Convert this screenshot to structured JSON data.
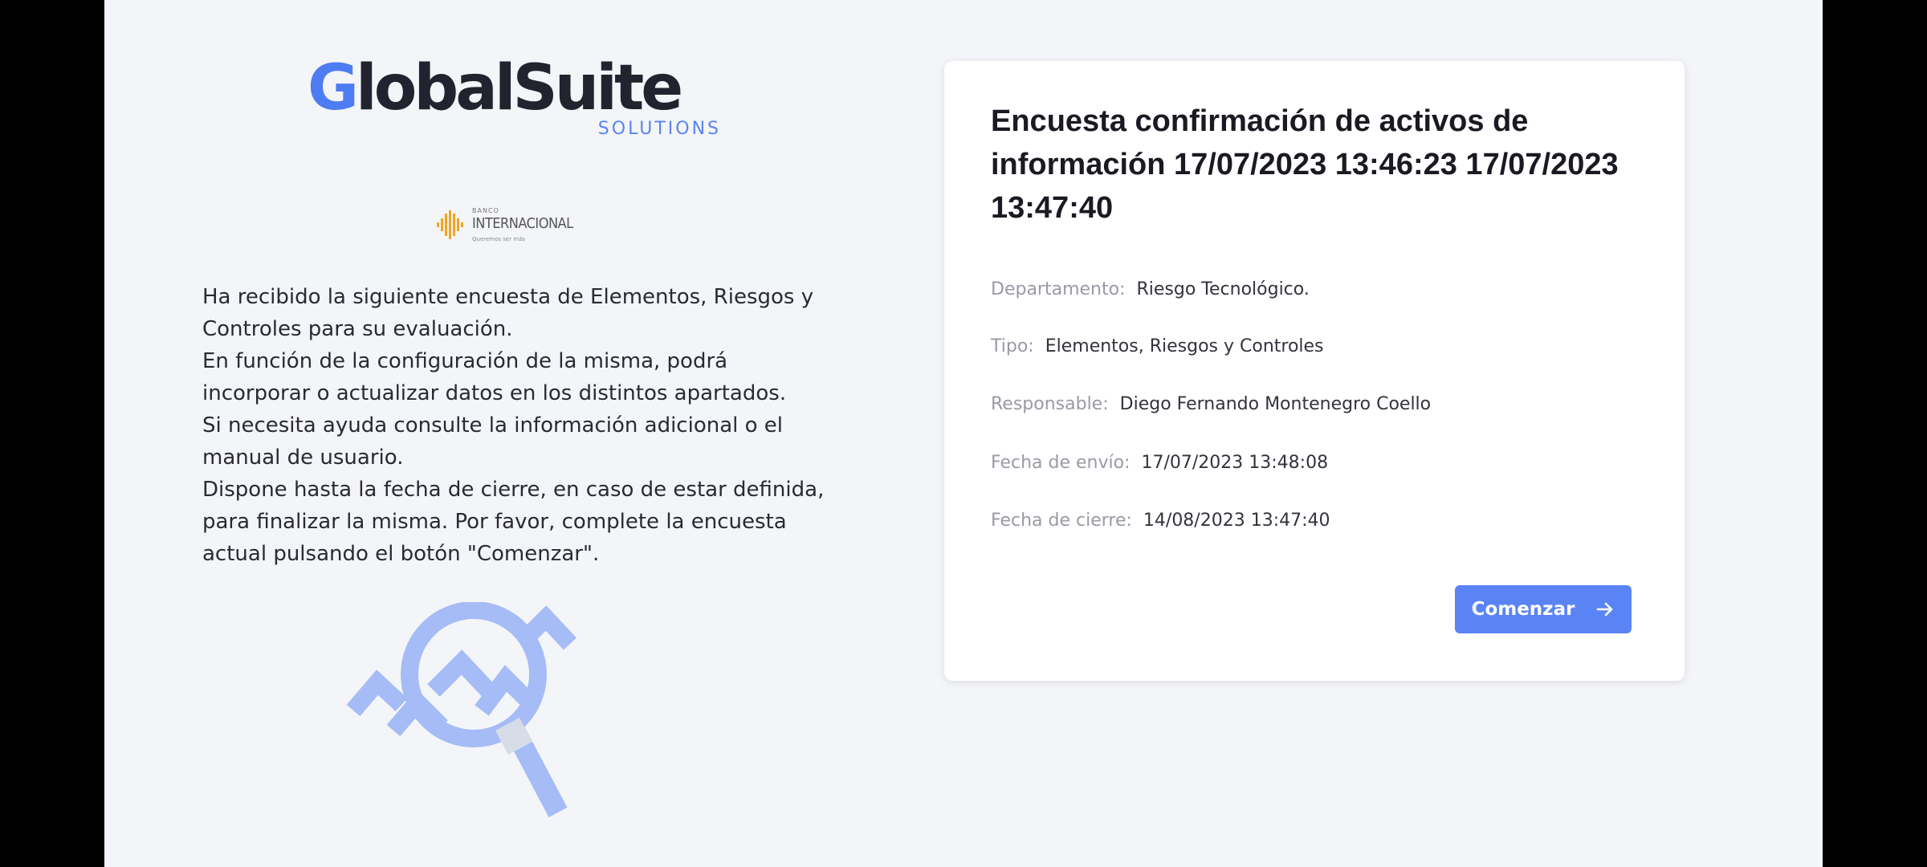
{
  "logo": {
    "wordmark_first": "G",
    "wordmark_rest": "lobalSuite",
    "subtitle": "SOLUTIONS"
  },
  "bank_logo": {
    "small": "BANCO",
    "name": "INTERNACIONAL",
    "tagline": "Queremos ser más"
  },
  "intro": {
    "paragraphs": [
      "Ha recibido la siguiente encuesta de Elementos, Riesgos y Controles para su evaluación.",
      "En función de la configuración de la misma, podrá incorporar o actualizar datos en los distintos apartados.",
      "Si necesita ayuda consulte la información adicional o el manual de usuario.",
      "Dispone hasta la fecha de cierre, en caso de estar definida, para finalizar la misma. Por favor, complete la encuesta actual pulsando el botón \"Comenzar\"."
    ]
  },
  "card": {
    "title": "Encuesta confirmación de activos de información 17/07/2023 13:46:23 17/07/2023 13:47:40",
    "fields": {
      "departamento": {
        "label": "Departamento:",
        "value": "Riesgo Tecnológico."
      },
      "tipo": {
        "label": "Tipo:",
        "value": "Elementos, Riesgos y Controles"
      },
      "responsable": {
        "label": "Responsable:",
        "value": "Diego Fernando Montenegro Coello"
      },
      "fecha_envio": {
        "label": "Fecha de envío:",
        "value": "17/07/2023 13:48:08"
      },
      "fecha_cierre": {
        "label": "Fecha de cierre:",
        "value": "14/08/2023 13:47:40"
      }
    },
    "start_button": {
      "label": "Comenzar",
      "icon": "arrow-right-icon"
    }
  },
  "colors": {
    "accent": "#5a84f5",
    "background": "#f4f5f8",
    "illustration": "#a6bcf6",
    "bank_logo": "#f2a61e"
  }
}
